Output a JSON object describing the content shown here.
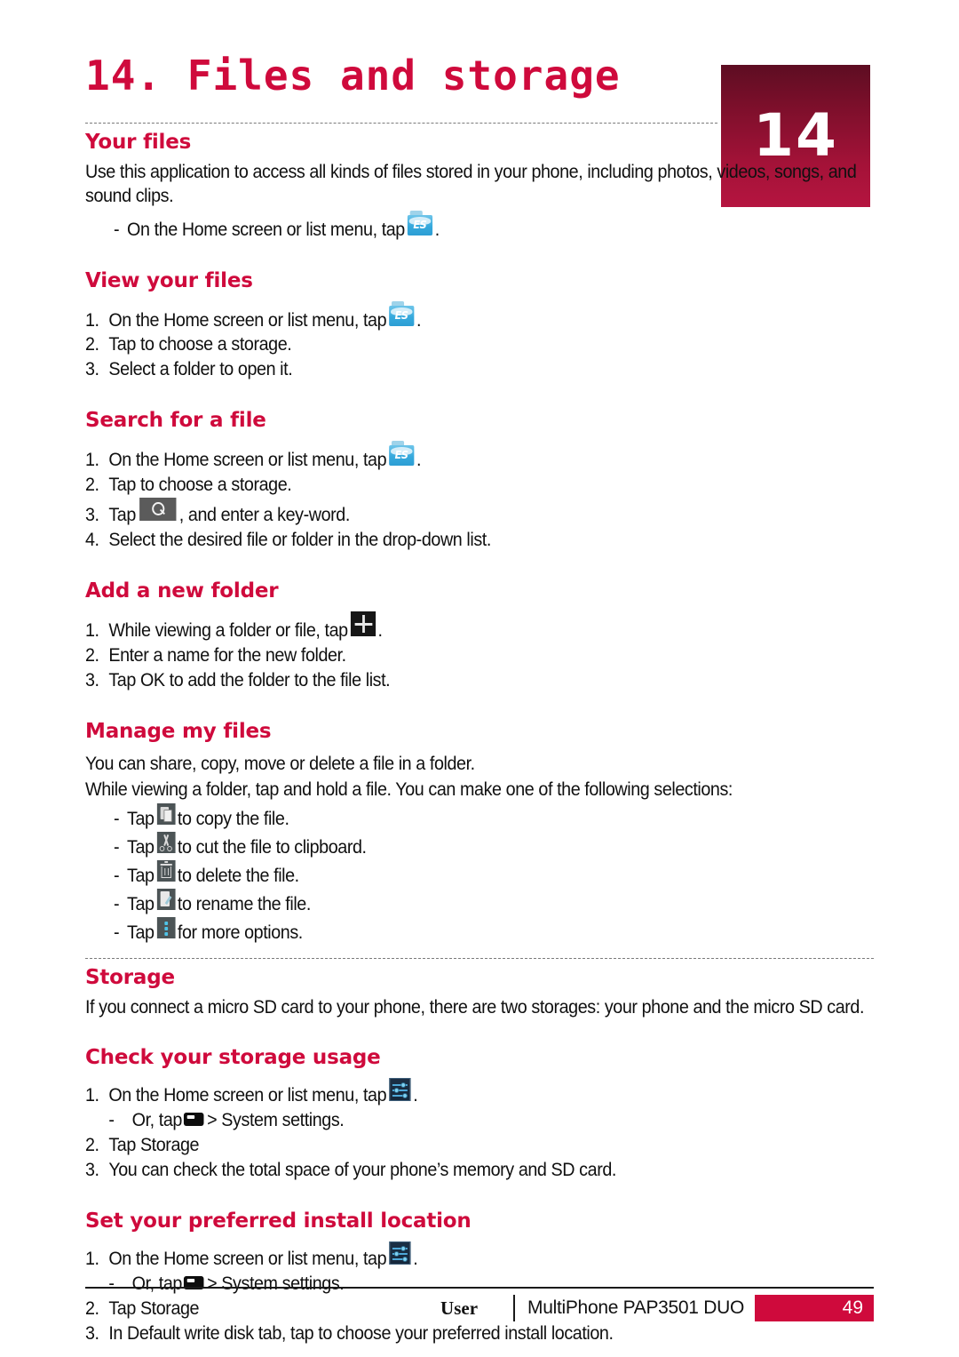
{
  "chapter": {
    "title": "14. Files and storage",
    "badge_number": "14",
    "accent_color": "#cf0a3c",
    "badge_gradient_top": "#5d0d22",
    "badge_gradient_bottom": "#b51540"
  },
  "sections": [
    {
      "id": "your-files",
      "heading": "Your files",
      "paragraph": "Use this application to access all kinds of files stored in your phone, including photos, videos, songs, and sound clips.",
      "dash_item_pre": "On the Home screen or list menu, tap",
      "dash_item_post": "."
    },
    {
      "id": "view-your-files",
      "heading": "View your files",
      "steps": [
        {
          "marker": "1.",
          "pre": "On the Home screen or list menu, tap",
          "icon": "es-file-explorer-icon",
          "post": "."
        },
        {
          "marker": "2.",
          "pre": "Tap to choose a storage.",
          "icon": "",
          "post": ""
        },
        {
          "marker": "3.",
          "pre": "Select a folder to open it.",
          "icon": "",
          "post": ""
        }
      ]
    },
    {
      "id": "search-for-a-file",
      "heading": "Search for a file",
      "steps": [
        {
          "marker": "1.",
          "pre": "On the Home screen or list menu, tap",
          "icon": "es-file-explorer-icon",
          "post": "."
        },
        {
          "marker": "2.",
          "pre": "Tap to choose a storage.",
          "icon": "",
          "post": ""
        },
        {
          "marker": "3.",
          "pre": "Tap",
          "icon": "search-icon",
          "post": ", and enter a key-word."
        },
        {
          "marker": "4.",
          "pre": "Select the desired file or folder in the drop-down list.",
          "icon": "",
          "post": ""
        }
      ]
    },
    {
      "id": "add-a-new-folder",
      "heading": "Add a new folder",
      "steps": [
        {
          "marker": "1.",
          "pre": "While viewing a folder or file, tap",
          "icon": "plus-icon",
          "post": "."
        },
        {
          "marker": "2.",
          "pre": "Enter a name for the new folder.",
          "icon": "",
          "post": ""
        },
        {
          "marker": "3.",
          "pre": "Tap OK to add the folder to the file list.",
          "icon": "",
          "post": ""
        }
      ]
    },
    {
      "id": "manage-my-files",
      "heading": "Manage my files",
      "paragraph1": "You can share, copy, move or delete a file in a folder.",
      "paragraph2": "While viewing a folder, tap and hold a file. You can make one of the following selections:",
      "dash_items": [
        {
          "pre": "Tap",
          "icon": "copy-icon",
          "post": "to copy the file."
        },
        {
          "pre": "Tap",
          "icon": "cut-icon",
          "post": "to cut the file to clipboard."
        },
        {
          "pre": "Tap",
          "icon": "trash-icon",
          "post": "to delete the file."
        },
        {
          "pre": "Tap",
          "icon": "rename-icon",
          "post": "to rename the file."
        },
        {
          "pre": "Tap",
          "icon": "more-options-icon",
          "post": "for more options."
        }
      ]
    },
    {
      "id": "storage",
      "heading": "Storage",
      "paragraph": "If you connect a micro SD card to your phone, there are two storages: your phone and the micro SD card."
    },
    {
      "id": "check-your-storage-usage",
      "heading": "Check your storage usage",
      "steps": [
        {
          "marker": "1.",
          "pre": "On the Home screen or list menu, tap",
          "icon": "settings-icon",
          "post": "."
        },
        {
          "marker": "-",
          "pre": "Or, tap",
          "icon": "menu-icon",
          "post": "> System settings.",
          "sub": true
        },
        {
          "marker": "2.",
          "pre": "Tap Storage",
          "icon": "",
          "post": ""
        },
        {
          "marker": "3.",
          "pre": "You can check the total space of your phone’s memory and SD card.",
          "icon": "",
          "post": ""
        }
      ]
    },
    {
      "id": "set-your-preferred-install-location",
      "heading": "Set your preferred install location",
      "steps": [
        {
          "marker": "1.",
          "pre": "On the Home screen or list menu, tap",
          "icon": "settings-icon",
          "post": "."
        },
        {
          "marker": "-",
          "pre": "Or, tap",
          "icon": "menu-icon",
          "post": "> System settings.",
          "sub": true
        },
        {
          "marker": "2.",
          "pre": "Tap Storage",
          "icon": "",
          "post": ""
        },
        {
          "marker": "3.",
          "pre": "In Default write disk tab, tap to choose your preferred install location.",
          "icon": "",
          "post": ""
        }
      ]
    }
  ],
  "footer": {
    "user_label": "User",
    "model": "MultiPhone PAP3501 DUO",
    "page_number": "49"
  }
}
